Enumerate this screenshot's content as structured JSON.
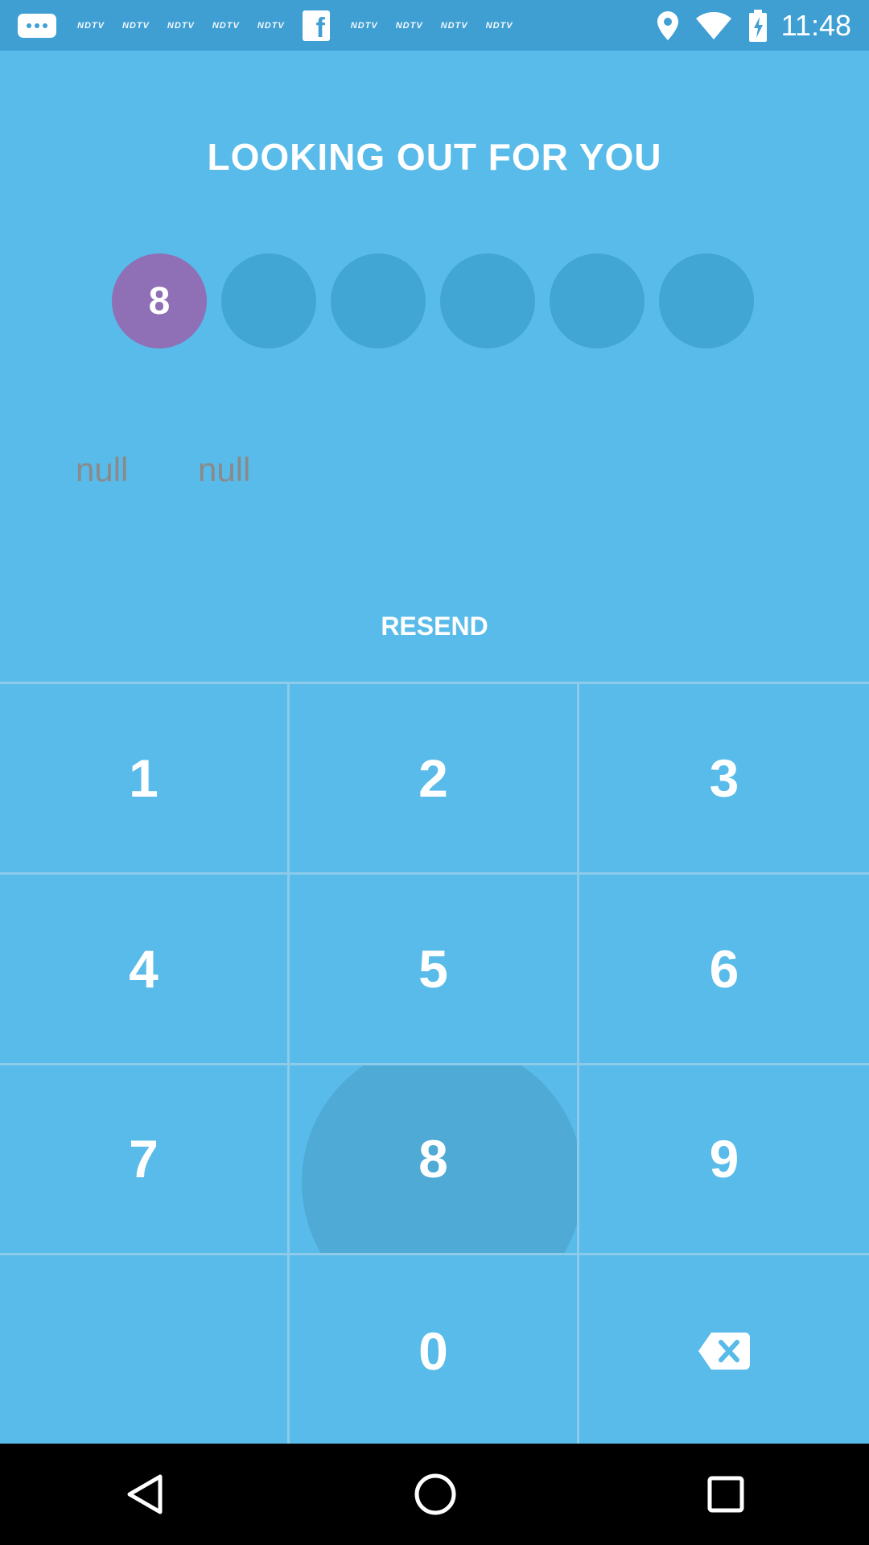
{
  "status_bar": {
    "ndtv_label": "NDTV",
    "clock": "11:48"
  },
  "title": "LOOKING OUT FOR YOU",
  "code": {
    "digits": [
      "8",
      "",
      "",
      "",
      "",
      ""
    ]
  },
  "info": {
    "left": "null",
    "right": "null"
  },
  "resend_label": "RESEND",
  "keypad": {
    "keys": [
      "1",
      "2",
      "3",
      "4",
      "5",
      "6",
      "7",
      "8",
      "9",
      "",
      "0"
    ]
  },
  "colors": {
    "background": "#59bbe9",
    "status_bar": "#3f9fd3",
    "filled_dot": "#8f6fb5",
    "empty_dot": "#42a6d4"
  },
  "icons": [
    "chat-bubble-icon",
    "facebook-icon",
    "location-icon",
    "wifi-icon",
    "battery-icon",
    "backspace-icon",
    "back-icon",
    "home-icon",
    "recents-icon"
  ]
}
